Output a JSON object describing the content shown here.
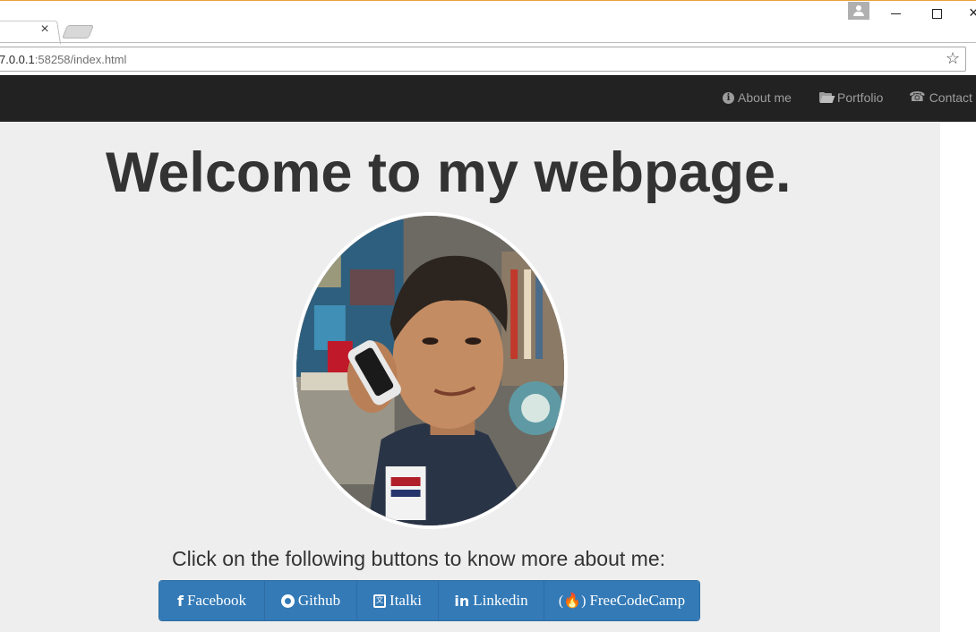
{
  "browser": {
    "tab_close_glyph": "×",
    "url_host": "7.0.0.1",
    "url_rest": ":58258/index.html"
  },
  "nav": {
    "items": [
      {
        "label": "About me",
        "icon": "info-circle-icon"
      },
      {
        "label": "Portfolio",
        "icon": "folder-open-icon"
      },
      {
        "label": "Contact",
        "icon": "phone-icon"
      }
    ]
  },
  "main": {
    "headline": "Welcome to my webpage.",
    "prompt": "Click on the following buttons to know more about me:",
    "buttons": [
      {
        "label": "Facebook",
        "icon": "facebook-icon"
      },
      {
        "label": "Github",
        "icon": "github-icon"
      },
      {
        "label": "Italki",
        "icon": "italki-icon"
      },
      {
        "label": "Linkedin",
        "icon": "linkedin-icon"
      },
      {
        "label": "FreeCodeCamp",
        "icon": "freecodecamp-icon"
      }
    ]
  },
  "colors": {
    "navbar": "#222222",
    "nav_text": "#9d9d9d",
    "page_bg": "#eeeeee",
    "button": "#337ab7",
    "button_border": "#2e6da4",
    "heading_text": "#333333"
  }
}
